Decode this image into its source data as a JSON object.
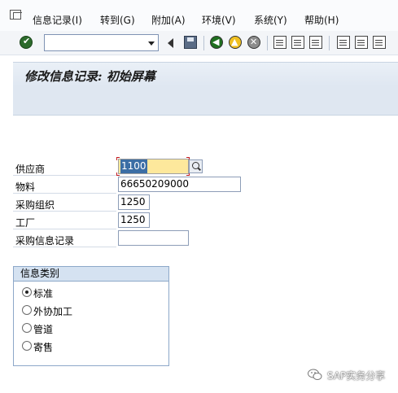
{
  "menubar": {
    "items": [
      "信息记录(I)",
      "转到(G)",
      "附加(A)",
      "环境(V)",
      "系统(Y)",
      "帮助(H)"
    ]
  },
  "toolbar": {
    "command_field_value": "",
    "icons": [
      "enter-icon",
      "back-arrow-icon",
      "save-icon",
      "back-icon",
      "exit-icon",
      "cancel-icon",
      "print-icon",
      "find-icon",
      "find-next-icon",
      "first-page-icon",
      "previous-page-icon",
      "next-page-icon"
    ]
  },
  "title": "修改信息记录: 初始屏幕",
  "form": {
    "vendor": {
      "label": "供应商",
      "value": "1100"
    },
    "material": {
      "label": "物料",
      "value": "66650209000"
    },
    "purch_org": {
      "label": "采购组织",
      "value": "1250"
    },
    "plant": {
      "label": "工厂",
      "value": "1250"
    },
    "info_record": {
      "label": "采购信息记录",
      "value": ""
    }
  },
  "info_category": {
    "title": "信息类别",
    "options": [
      {
        "label": "标准",
        "selected": true
      },
      {
        "label": "外协加工",
        "selected": false
      },
      {
        "label": "管道",
        "selected": false
      },
      {
        "label": "寄售",
        "selected": false
      }
    ]
  },
  "watermark": {
    "text": "SAP实务分享"
  },
  "colors": {
    "title_bar": "#dfe7f1",
    "vendor_field_bg": "#fde89c",
    "groupbox_header": "#d5e2f1"
  }
}
